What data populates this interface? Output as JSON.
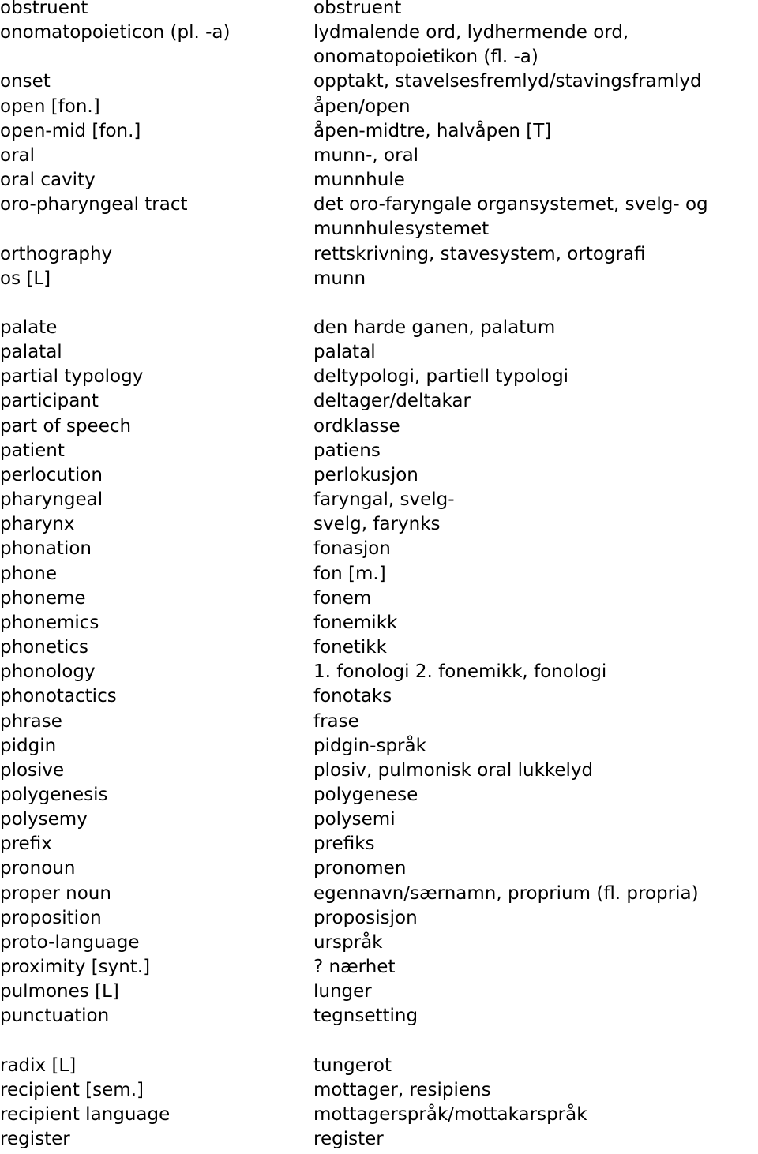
{
  "document": {
    "type": "bilingual-glossary",
    "languages": [
      "English",
      "Norwegian"
    ]
  },
  "entries": [
    {
      "term": "obstruent",
      "translation": "obstruent"
    },
    {
      "term": "onomatopoieticon (pl. -a)",
      "translation": "lydmalende ord, lydhermende ord,\nonomatopoietikon (fl. -a)"
    },
    {
      "term": "onset",
      "translation": "opptakt, stavelsesfremlyd/stavingsframlyd"
    },
    {
      "term": "open [fon.]",
      "translation": "åpen/open"
    },
    {
      "term": "open-mid [fon.]",
      "translation": "åpen-midtre, halvåpen [T]"
    },
    {
      "term": "oral",
      "translation": "munn-, oral"
    },
    {
      "term": "oral cavity",
      "translation": "munnhule"
    },
    {
      "term": "oro-pharyngeal tract",
      "translation": "det oro-faryngale organsystemet, svelg- og\nmunnhulesystemet"
    },
    {
      "term": "orthography",
      "translation": "rettskrivning, stavesystem, ortografi"
    },
    {
      "term": "os [L]",
      "translation": "munn",
      "gap_after": true
    },
    {
      "term": "palate",
      "translation": "den harde ganen, palatum"
    },
    {
      "term": "palatal",
      "translation": "palatal"
    },
    {
      "term": "partial typology",
      "translation": "deltypologi, partiell typologi"
    },
    {
      "term": "participant",
      "translation": "deltager/deltakar"
    },
    {
      "term": "part of speech",
      "translation": "ordklasse"
    },
    {
      "term": "patient",
      "translation": "patiens"
    },
    {
      "term": "perlocution",
      "translation": "perlokusjon"
    },
    {
      "term": "pharyngeal",
      "translation": "faryngal, svelg-"
    },
    {
      "term": "pharynx",
      "translation": "svelg, farynks"
    },
    {
      "term": "phonation",
      "translation": "fonasjon"
    },
    {
      "term": "phone",
      "translation": "fon [m.]"
    },
    {
      "term": "phoneme",
      "translation": "fonem"
    },
    {
      "term": "phonemics",
      "translation": "fonemikk"
    },
    {
      "term": "phonetics",
      "translation": "fonetikk"
    },
    {
      "term": "phonology",
      "translation": "1. fonologi 2. fonemikk, fonologi"
    },
    {
      "term": "phonotactics",
      "translation": "fonotaks"
    },
    {
      "term": "phrase",
      "translation": "frase"
    },
    {
      "term": "pidgin",
      "translation": "pidgin-språk"
    },
    {
      "term": "plosive",
      "translation": "plosiv, pulmonisk oral lukkelyd"
    },
    {
      "term": "polygenesis",
      "translation": "polygenese"
    },
    {
      "term": "polysemy",
      "translation": "polysemi"
    },
    {
      "term": "prefix",
      "translation": "prefiks"
    },
    {
      "term": "pronoun",
      "translation": "pronomen"
    },
    {
      "term": "proper noun",
      "translation": "egennavn/særnamn, proprium (fl. propria)"
    },
    {
      "term": "proposition",
      "translation": "proposisjon"
    },
    {
      "term": "proto-language",
      "translation": "urspråk"
    },
    {
      "term": "proximity [synt.]",
      "translation": "? nærhet"
    },
    {
      "term": "pulmones [L]",
      "translation": "lunger"
    },
    {
      "term": "punctuation",
      "translation": "tegnsetting",
      "gap_after": true
    },
    {
      "term": "radix [L]",
      "translation": "tungerot"
    },
    {
      "term": "recipient [sem.]",
      "translation": "mottager, resipiens"
    },
    {
      "term": "recipient language",
      "translation": "mottagerspråk/mottakarspråk"
    },
    {
      "term": "register",
      "translation": "register"
    }
  ]
}
